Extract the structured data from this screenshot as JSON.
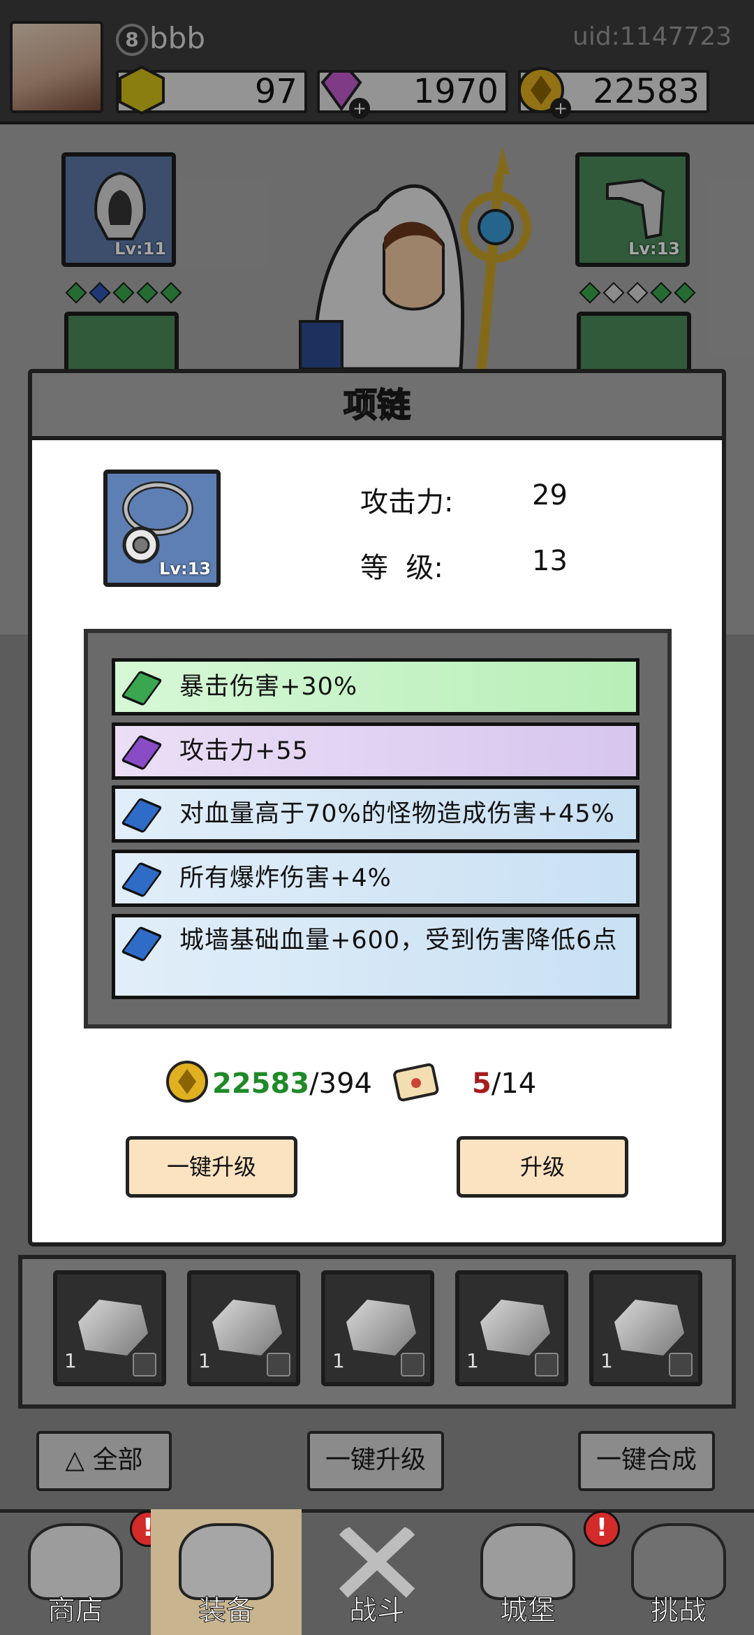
{
  "header": {
    "level": "8",
    "username": "bbb",
    "uid": "uid:1147723",
    "resources": [
      {
        "name": "gold-hex",
        "value": "97",
        "color": "#d6c21a"
      },
      {
        "name": "diamond",
        "value": "1970",
        "color": "#c55bd0"
      },
      {
        "name": "coin",
        "value": "22583",
        "color": "#e0b020"
      }
    ]
  },
  "equipment": {
    "hood_level": "Lv:11",
    "pants_level": "Lv:13"
  },
  "dialog": {
    "title": "项链",
    "item_level": "Lv:13",
    "stats": [
      {
        "label": "攻击力:",
        "value": "29"
      },
      {
        "label": "等  级:",
        "value": "13"
      }
    ],
    "affixes": [
      {
        "text": "暴击伤害+30%",
        "rarity": "green",
        "color": "#c8f5c9"
      },
      {
        "text": "攻击力+55",
        "rarity": "purple",
        "color": "#e1d2f2"
      },
      {
        "text": "对血量高于70%的怪物造成伤害+45%",
        "rarity": "blue",
        "color": "#d3e6f5"
      },
      {
        "text": "所有爆炸伤害+4%",
        "rarity": "blue",
        "color": "#d3e6f5"
      },
      {
        "text": "城墙基础血量+600，受到伤害降低6点",
        "rarity": "blue",
        "color": "#d3e6f5"
      }
    ],
    "coin_have": "22583",
    "coin_need": "/394",
    "scroll_have": "5",
    "scroll_need": "/14",
    "btn_upgrade_all": "一键升级",
    "btn_upgrade": "升级"
  },
  "inventory": {
    "items": [
      {
        "count": "1",
        "icon": "boot-icon"
      },
      {
        "count": "1",
        "icon": "pants-icon"
      },
      {
        "count": "1",
        "icon": "pants-icon"
      },
      {
        "count": "1",
        "icon": "pants-icon"
      },
      {
        "count": "1",
        "icon": "ring-icon"
      }
    ]
  },
  "controls": {
    "filter": "全部",
    "upgrade_all": "一键升级",
    "merge_all": "一键合成"
  },
  "tabs": [
    {
      "label": "商店",
      "alert": "!"
    },
    {
      "label": "装备",
      "alert": ""
    },
    {
      "label": "战斗",
      "alert": ""
    },
    {
      "label": "城堡",
      "alert": "!"
    },
    {
      "label": "挑战",
      "alert": ""
    }
  ]
}
